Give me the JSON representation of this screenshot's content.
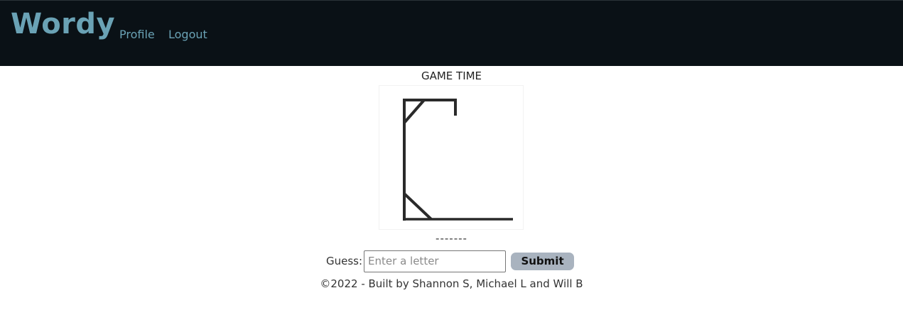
{
  "navbar": {
    "brand": "Wordy",
    "links": [
      {
        "label": "Profile"
      },
      {
        "label": "Logout"
      }
    ]
  },
  "game": {
    "title": "GAME TIME",
    "word_display": "-------",
    "guess_label": "Guess:",
    "guess_placeholder": "Enter a letter",
    "guess_value": "",
    "submit_label": "Submit"
  },
  "footer": {
    "text": "©2022 - Built by Shannon S, Michael L and Will B"
  },
  "colors": {
    "navbar_bg": "#0a1116",
    "brand": "#6aa2b5",
    "submit_bg": "#a9b3bf"
  }
}
